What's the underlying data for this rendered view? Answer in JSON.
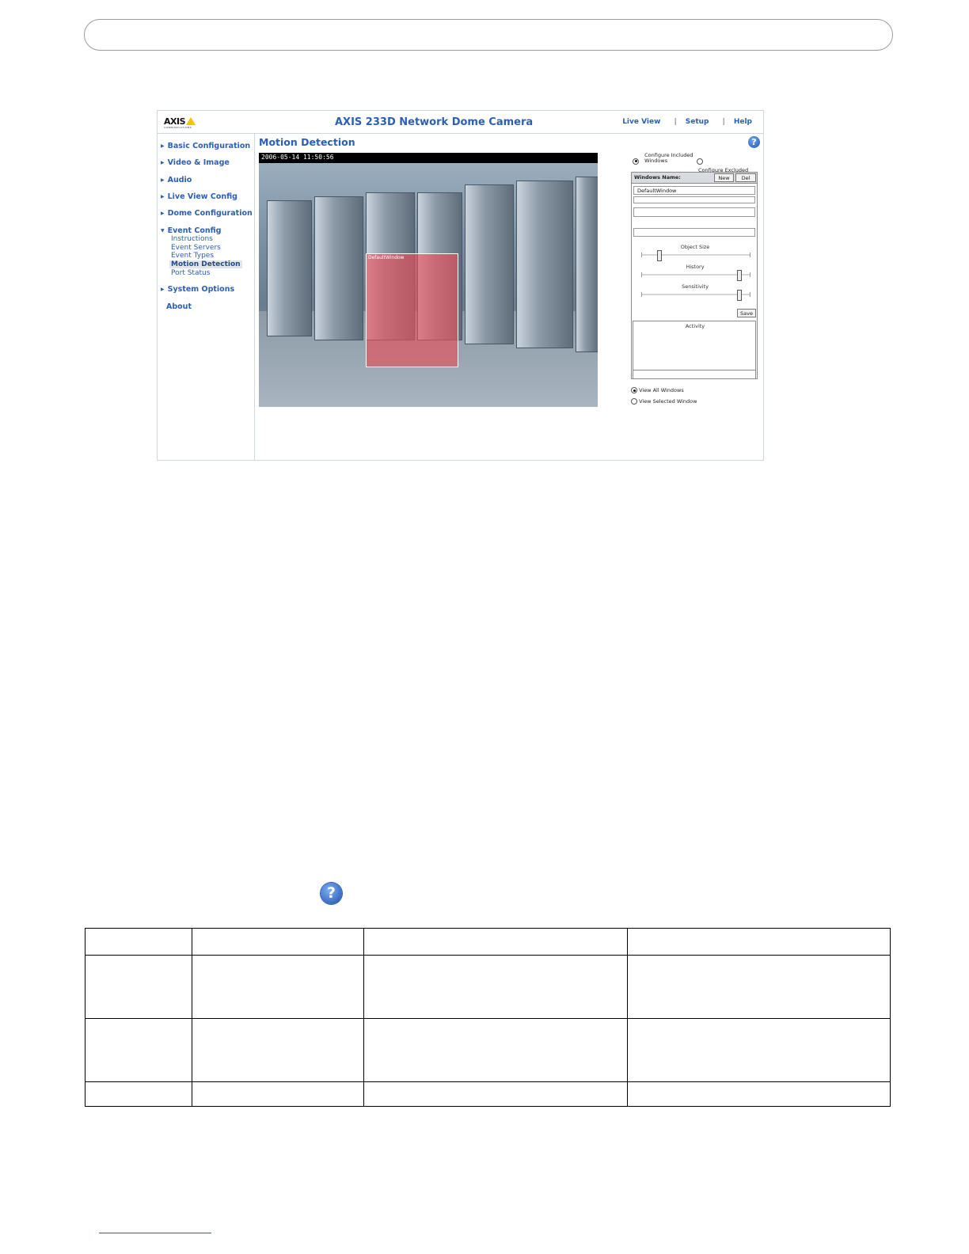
{
  "screenshot": {
    "logo": "AXIS",
    "logo_sub": "COMMUNICATIONS",
    "title": "AXIS 233D Network Dome Camera",
    "top_links": [
      "Live View",
      "Setup",
      "Help"
    ],
    "top_sep": "|",
    "nav": [
      {
        "label": "Basic Configuration"
      },
      {
        "label": "Video & Image"
      },
      {
        "label": "Audio"
      },
      {
        "label": "Live View Config"
      },
      {
        "label": "Dome Configuration"
      },
      {
        "label": "Event Config"
      },
      {
        "label": "System Options"
      },
      {
        "label": "About"
      }
    ],
    "event_sub": [
      "Instructions",
      "Event Servers",
      "Event Types",
      "Motion Detection",
      "Port Status"
    ],
    "page_title": "Motion Detection",
    "help_glyph": "?",
    "timestamp": "2006-05-14 11:50:56",
    "window_label": "DefaultWindow",
    "configure_included": "Configure Included Windows",
    "configure_excluded": "Configure Excluded Windows",
    "windows_name_header": "Windows Name:",
    "new_button": "New",
    "del_button": "Del",
    "window_entry": "DefaultWindow",
    "sliders": [
      {
        "label": "Object Size",
        "value": 0.15
      },
      {
        "label": "History",
        "value": 0.92
      },
      {
        "label": "Sensitivity",
        "value": 0.92
      }
    ],
    "save_button": "Save",
    "activity_label": "Activity",
    "view_all": "View All Windows",
    "view_selected": "View Selected Window"
  },
  "help_icon_glyph": "?",
  "table": {
    "rows": 4,
    "cols": 4
  },
  "colors": {
    "link_blue": "#2b5fb4",
    "motion_window": "#e6505a"
  }
}
